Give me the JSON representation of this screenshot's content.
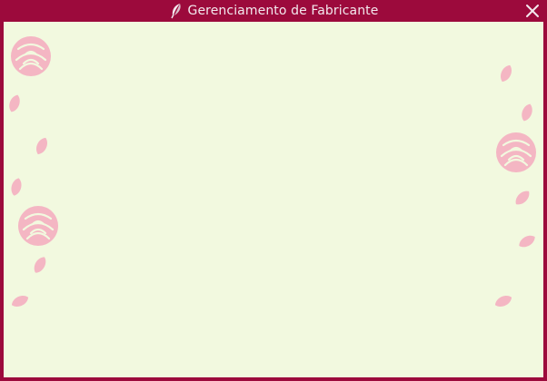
{
  "window": {
    "title": "Gerenciamento de Fabricante",
    "title_icon": "quill-feather-icon",
    "close_icon": "close-icon"
  },
  "theme": {
    "frame_color": "#9c0a3c",
    "content_background": "#f2f9df",
    "decoration_color": "#f4b6c3"
  },
  "content": {
    "decoration_icons": [
      "rose-icon",
      "petal-icon"
    ]
  }
}
